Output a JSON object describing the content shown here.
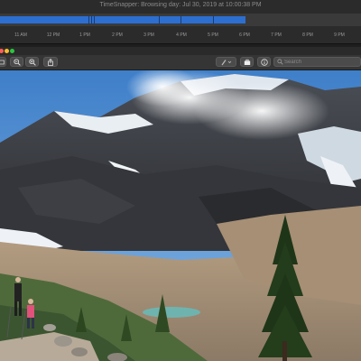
{
  "timeline": {
    "title": "TimeSnapper: Browsing day: Jul 30, 2019 at 10:00:38 PM",
    "hours": [
      "11 AM",
      "12 PM",
      "1 PM",
      "2 PM",
      "3 PM",
      "4 PM",
      "5 PM",
      "6 PM",
      "7 PM",
      "8 PM",
      "9 PM"
    ],
    "fill_color": "#2d6fd1"
  },
  "toolbar": {
    "buttons": [
      {
        "icon": "fit-window-icon"
      },
      {
        "icon": "zoom-out-icon"
      },
      {
        "icon": "zoom-in-icon"
      },
      {
        "icon": "share-icon"
      },
      {
        "icon": "pen-markup-icon"
      },
      {
        "icon": "briefcase-icon"
      },
      {
        "icon": "info-icon"
      }
    ],
    "search_placeholder": "Search"
  },
  "colors": {
    "accent": "#2d6fd1",
    "close": "#ff5f57",
    "minimize": "#febc2e",
    "zoom": "#28c840"
  },
  "photo": {
    "subject": "mountain-landscape-image"
  }
}
